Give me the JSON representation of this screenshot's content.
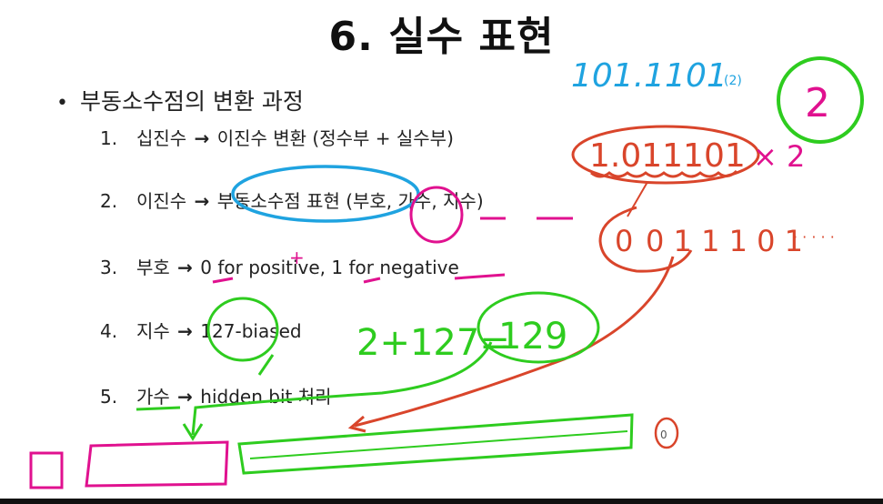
{
  "slide": {
    "title": "6. 실수 표현",
    "bullet": "부동소수점의 변환 과정",
    "steps": [
      {
        "num": "1.",
        "left": "십진수",
        "arrow": "→",
        "right": "이진수 변환 (정수부 + 실수부)"
      },
      {
        "num": "2.",
        "left": "이진수",
        "arrow": "→",
        "right": "부동소수점 표현 (부호, 가수, 지수)"
      },
      {
        "num": "3.",
        "left": "부호",
        "arrow": "→",
        "right": "0 for positive, 1 for negative"
      },
      {
        "num": "4.",
        "left": "지수",
        "arrow": "→",
        "right": "127-biased"
      },
      {
        "num": "5.",
        "left": "가수",
        "arrow": "→",
        "right": "hidden bit 처리"
      }
    ]
  },
  "annotations": {
    "binary_number": "101.1101",
    "binary_base": "(2)",
    "normalized": "1.011101",
    "times_two": "× 2",
    "exponent_circled": "2",
    "mantissa_bits": "0 1 1 1 0 1",
    "mantissa_trail": "· · · · ·",
    "sign_mark": "0",
    "exponent_calc": "2+127=",
    "exponent_result": "129",
    "small_circle_mark": "0",
    "plus_mark": "+"
  },
  "colors": {
    "blue_ink": "#1fa3e0",
    "magenta_ink": "#e0118f",
    "green_ink": "#2ecc1f",
    "red_ink": "#d9452b"
  }
}
